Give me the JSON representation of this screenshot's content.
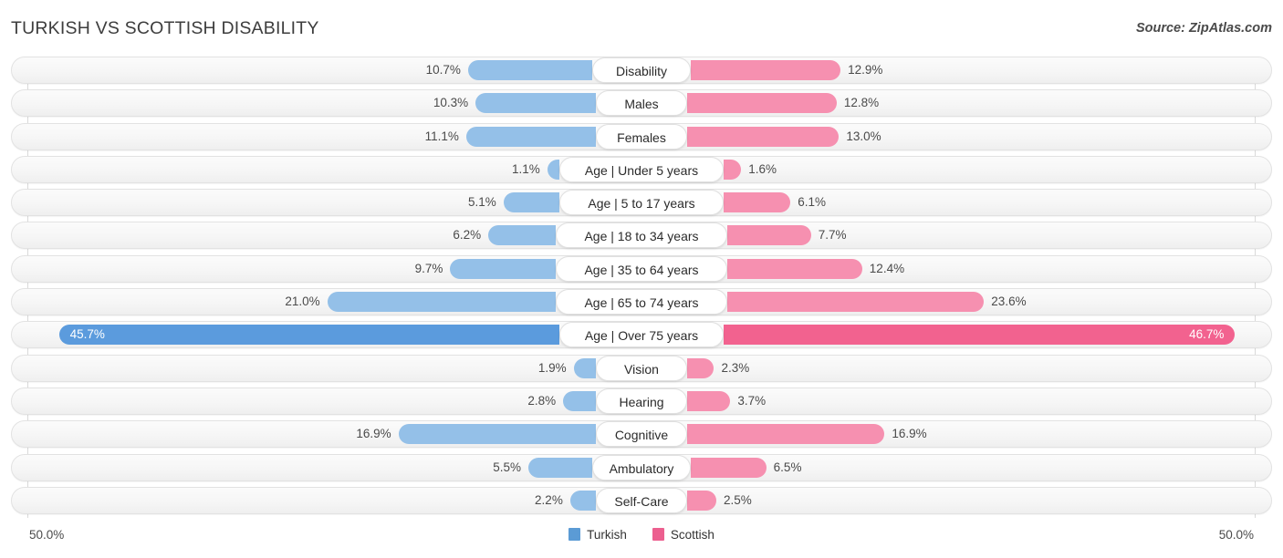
{
  "header": {
    "title": "TURKISH VS SCOTTISH DISABILITY",
    "source": "Source: ZipAtlas.com"
  },
  "footer": {
    "axis_min": "50.0%",
    "axis_max": "50.0%",
    "legend": [
      {
        "label": "Turkish",
        "color": "#5b9bd5"
      },
      {
        "label": "Scottish",
        "color": "#ec5f8f"
      }
    ]
  },
  "colors": {
    "turkish_bar": "#94c0e8",
    "scottish_bar": "#f690b0",
    "turkish_bar_highlight": "#5b9bdd",
    "scottish_bar_highlight": "#f2628f",
    "track": "#f6f6f6",
    "gridline": "#d9d9d9"
  },
  "chart_data": {
    "type": "bar",
    "orientation": "horizontal-diverging",
    "title": "TURKISH VS SCOTTISH DISABILITY",
    "xlabel": "",
    "ylabel": "",
    "axis_max_percent": 50.0,
    "grid": true,
    "legend_position": "bottom-center",
    "categories": [
      "Disability",
      "Males",
      "Females",
      "Age | Under 5 years",
      "Age | 5 to 17 years",
      "Age | 18 to 34 years",
      "Age | 35 to 64 years",
      "Age | 65 to 74 years",
      "Age | Over 75 years",
      "Vision",
      "Hearing",
      "Cognitive",
      "Ambulatory",
      "Self-Care"
    ],
    "series": [
      {
        "name": "Turkish",
        "side": "left",
        "color": "#94c0e8",
        "values": [
          10.7,
          10.3,
          11.1,
          1.1,
          5.1,
          6.2,
          9.7,
          21.0,
          45.7,
          1.9,
          2.8,
          16.9,
          5.5,
          2.2
        ],
        "labels": [
          "10.7%",
          "10.3%",
          "11.1%",
          "1.1%",
          "5.1%",
          "6.2%",
          "9.7%",
          "21.0%",
          "45.7%",
          "1.9%",
          "2.8%",
          "16.9%",
          "5.5%",
          "2.2%"
        ]
      },
      {
        "name": "Scottish",
        "side": "right",
        "color": "#f690b0",
        "values": [
          12.9,
          12.8,
          13.0,
          1.6,
          6.1,
          7.7,
          12.4,
          23.6,
          46.7,
          2.3,
          3.7,
          16.9,
          6.5,
          2.5
        ],
        "labels": [
          "12.9%",
          "12.8%",
          "13.0%",
          "1.6%",
          "6.1%",
          "7.7%",
          "12.4%",
          "23.6%",
          "46.7%",
          "2.3%",
          "3.7%",
          "16.9%",
          "6.5%",
          "2.5%"
        ]
      }
    ],
    "highlighted_rows": [
      8
    ]
  }
}
